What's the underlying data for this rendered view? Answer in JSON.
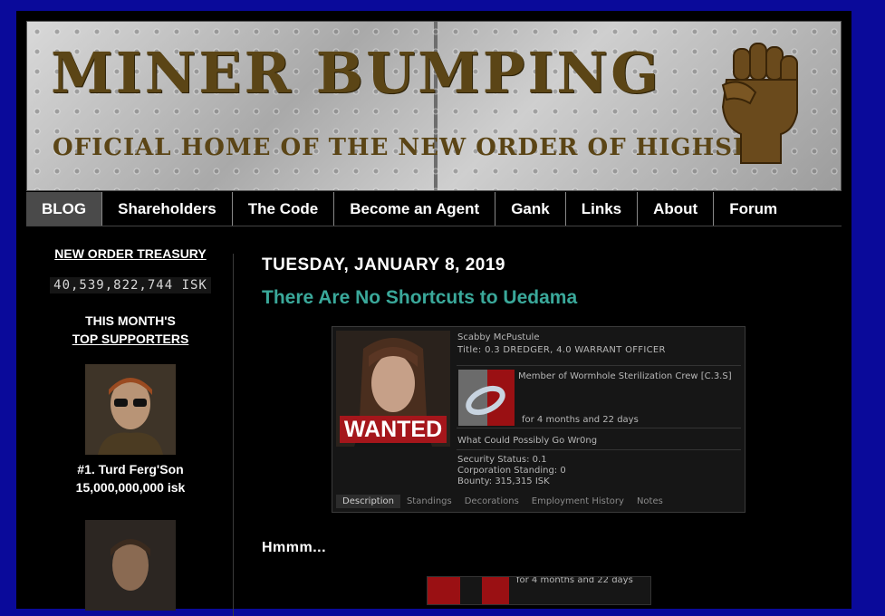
{
  "header": {
    "title": "MINER BUMPING",
    "subtitle": "OFICIAL HOME OF THE NEW ORDER OF HIGHSEC"
  },
  "nav": {
    "items": [
      "BLOG",
      "Shareholders",
      "The Code",
      "Become an Agent",
      "Gank",
      "Links",
      "About",
      "Forum"
    ],
    "active": "BLOG"
  },
  "sidebar": {
    "treasury_heading": "NEW ORDER TREASURY",
    "treasury_value": "40,539,822,744 ISK",
    "supporters_line1": "THIS MONTH'S",
    "supporters_line2": "TOP SUPPORTERS",
    "supporters": [
      {
        "rank_name": "#1. Turd Ferg'Son",
        "amount": "15,000,000,000 isk"
      }
    ]
  },
  "post": {
    "date": "TUESDAY, JANUARY 8, 2019",
    "title": "There Are No Shortcuts to Uedama",
    "body_text": "Hmmm..."
  },
  "character_card": {
    "name": "Scabby McPustule",
    "title": "Title: 0.3 DREDGER, 4.0 WARRANT OFFICER",
    "wanted": "WANTED",
    "corp_membership": "Member of Wormhole Sterilization Crew [C.3.S]",
    "corp_duration": "for 4 months and 22 days",
    "bio": "What Could Possibly Go Wr0ng",
    "security_status": "Security Status: 0.1",
    "corp_standing": "Corporation Standing: 0",
    "bounty": "Bounty: 315,315 ISK",
    "tabs": [
      "Description",
      "Standings",
      "Decorations",
      "Employment History",
      "Notes"
    ],
    "active_tab": "Description"
  },
  "second_card": {
    "duration": "for 4 months and 22 days"
  },
  "colors": {
    "background": "#0a0a9a",
    "page": "#000000",
    "post_title": "#3aa89a",
    "wanted": "#a5161b",
    "banner_text": "#5b4516"
  }
}
